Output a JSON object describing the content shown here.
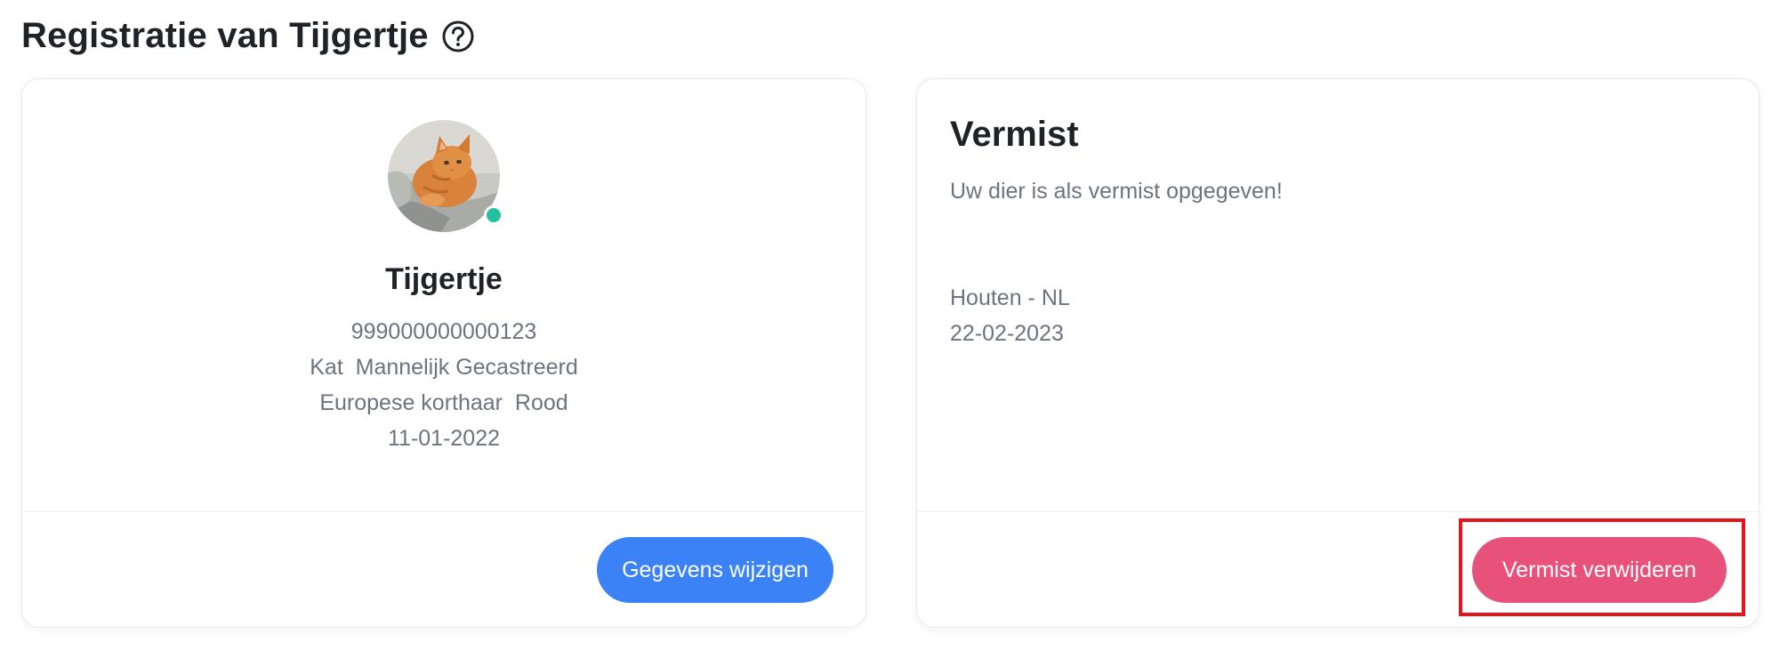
{
  "header": {
    "title": "Registratie van Tijgertje",
    "help_icon": "question-circle-icon"
  },
  "pet_card": {
    "name": "Tijgertje",
    "chip_number": "999000000000123",
    "species_line": "Kat  Mannelijk Gecastreerd",
    "breed_line": "Europese korthaar  Rood",
    "birth_date": "11-01-2022",
    "status_color": "#22c1a0",
    "edit_button_label": "Gegevens wijzigen",
    "edit_button_color": "#3b82f6"
  },
  "lost_card": {
    "title": "Vermist",
    "description": "Uw dier is als vermist opgegeven!",
    "location": "Houten - NL",
    "date": "22-02-2023",
    "remove_button_label": "Vermist verwijderen",
    "remove_button_color": "#e8517a"
  },
  "highlight": {
    "color": "#e3141b"
  }
}
